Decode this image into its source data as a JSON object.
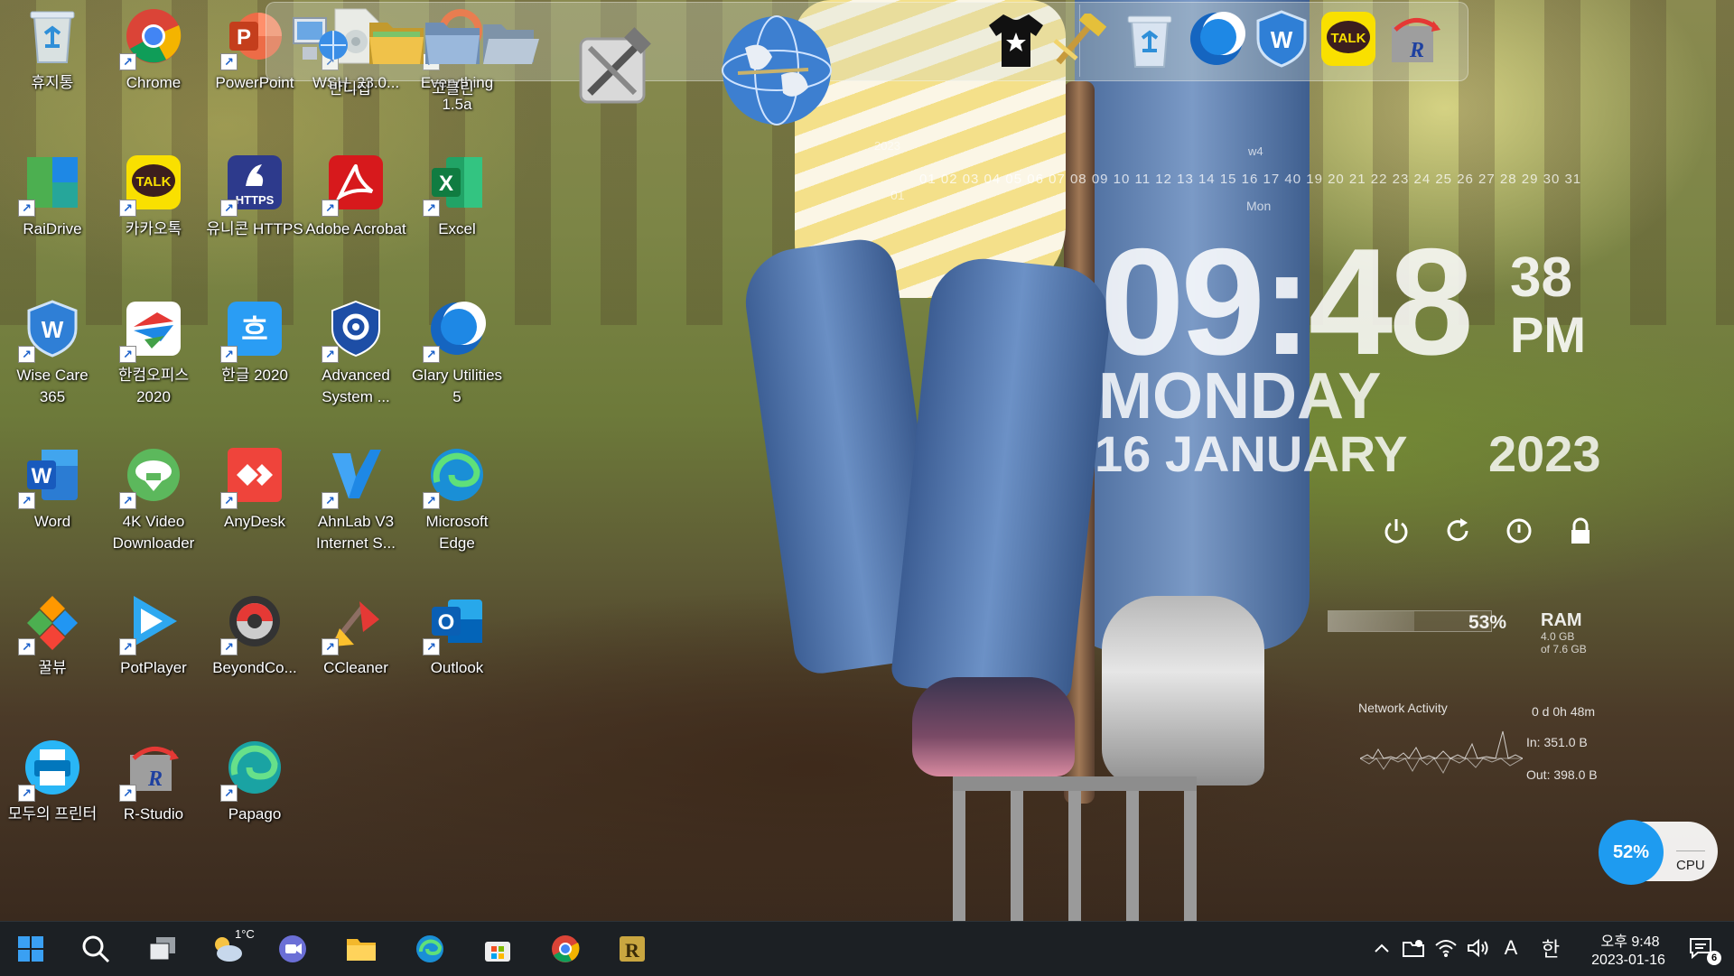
{
  "desktop_icons": [
    {
      "label": "휴지통",
      "icon": "recycle-bin-icon"
    },
    {
      "label": "Chrome",
      "icon": "chrome-icon"
    },
    {
      "label": "PowerPoint",
      "icon": "powerpoint-icon"
    },
    {
      "label": "WSH_23.0...",
      "icon": "file-icon"
    },
    {
      "label": "Everything 1.5a",
      "icon": "magnifier-icon"
    },
    {
      "label": "RaiDrive",
      "icon": "raidrive-icon"
    },
    {
      "label": "카카오톡",
      "icon": "kakaotalk-icon",
      "badge": "TALK"
    },
    {
      "label": "유니콘 HTTPS",
      "icon": "unicorn-icon",
      "badge": "HTTPS"
    },
    {
      "label": "Adobe Acrobat",
      "icon": "acrobat-icon"
    },
    {
      "label": "Excel",
      "icon": "excel-icon",
      "badge": "X"
    },
    {
      "label": "Wise Care 365",
      "icon": "wisecare-icon"
    },
    {
      "label": "한컴오피스 2020",
      "icon": "hancom-icon"
    },
    {
      "label": "한글 2020",
      "icon": "hangul-icon",
      "badge": "흐"
    },
    {
      "label": "Advanced System ...",
      "icon": "advanced-system-icon"
    },
    {
      "label": "Glary Utilities 5",
      "icon": "glary-icon"
    },
    {
      "label": "Word",
      "icon": "word-icon",
      "badge": "W"
    },
    {
      "label": "4K Video Downloader",
      "icon": "4k-downloader-icon"
    },
    {
      "label": "AnyDesk",
      "icon": "anydesk-icon"
    },
    {
      "label": "AhnLab V3 Internet S...",
      "icon": "ahnlab-icon",
      "badge": "V"
    },
    {
      "label": "Microsoft Edge",
      "icon": "edge-icon"
    },
    {
      "label": "꿀뷰",
      "icon": "honeyview-icon"
    },
    {
      "label": "PotPlayer",
      "icon": "potplayer-icon"
    },
    {
      "label": "BeyondCo...",
      "icon": "beyondcompare-icon"
    },
    {
      "label": "CCleaner",
      "icon": "ccleaner-icon"
    },
    {
      "label": "Outlook",
      "icon": "outlook-icon",
      "badge": "O"
    },
    {
      "label": "모두의 프린터",
      "icon": "printer-icon"
    },
    {
      "label": "R-Studio",
      "icon": "rstudio-icon"
    },
    {
      "label": "Papago",
      "icon": "papago-icon"
    }
  ],
  "dock": {
    "items": [
      {
        "icon": "computer-globe-icon"
      },
      {
        "icon": "folder-green-icon"
      },
      {
        "icon": "folder-blue-icon"
      },
      {
        "icon": "folder-open-icon"
      },
      {
        "icon": "tools-icon"
      },
      {
        "icon": "globe-icon"
      },
      {
        "icon": "tshirt-icon"
      },
      {
        "icon": "hammer-icon"
      },
      {
        "icon": "recycle-bin-icon"
      },
      {
        "icon": "glary-icon"
      },
      {
        "icon": "wisecare-icon"
      },
      {
        "icon": "kakaotalk-icon",
        "badge": "TALK"
      },
      {
        "icon": "rstudio-icon",
        "badge": "R"
      }
    ],
    "labels": [
      "반디집",
      "고클린"
    ]
  },
  "calendar": {
    "year": "2023",
    "month": "01",
    "days": "01 02 03 04 05 06 07 08 09 10 11 12 13 14 15 16 17 40 19 20 21 22 23 24 25 26 27 28 29 30 31",
    "week": "w4",
    "dow": "Mon"
  },
  "clock": {
    "time": "09:48",
    "seconds": "38",
    "ampm": "PM",
    "day": "MONDAY",
    "date": "16 JANUARY",
    "year": "2023"
  },
  "power_buttons": [
    "power-icon",
    "restart-icon",
    "sleep-icon",
    "lock-icon"
  ],
  "stats": {
    "ram_percent": "53%",
    "ram_fraction": 0.53,
    "ram_label": "RAM",
    "ram_used": "4.0 GB",
    "ram_total": "of 7.6 GB",
    "network_label": "Network Activity",
    "uptime": "0 d 0h 48m",
    "net_in": "In: 351.0 B",
    "net_out": "Out: 398.0 B",
    "cpu_percent": "52%",
    "cpu_label": "CPU"
  },
  "taskbar": {
    "weather_temp": "1°C",
    "apps": [
      "start-icon",
      "search-icon",
      "task-view-icon",
      "weather-icon",
      "chat-icon",
      "file-explorer-icon",
      "edge-icon",
      "store-icon",
      "chrome-icon",
      "rstudio-icon"
    ],
    "tray": [
      "chevron-up-icon",
      "network-folder-icon",
      "wifi-icon",
      "volume-icon"
    ],
    "ime_mode": "A",
    "ime_lang": "한",
    "clock_time": "오후 9:48",
    "clock_date": "2023-01-16",
    "notifications": "6"
  },
  "colors": {
    "taskbar_bg": "#1c2024",
    "cpu_accent": "#1e9bf0",
    "kakao_yellow": "#f9e000",
    "accent_blue": "#0078d4"
  }
}
